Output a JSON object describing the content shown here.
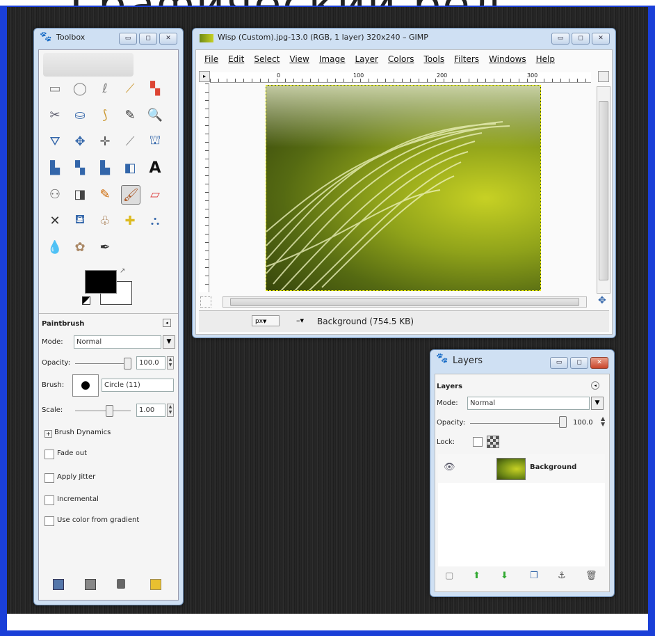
{
  "heading": "Графический ред",
  "toolbox": {
    "title": "Toolbox",
    "controls": [
      "▭",
      "◻",
      "✕"
    ],
    "tools_row1": [
      "▭",
      "◯",
      "ℓ",
      "⟋",
      "▚"
    ],
    "tools_row2": [
      "✂",
      "⛀",
      "⟆",
      "✎",
      "🔍"
    ],
    "tools_row3": [
      "⛛",
      "✥",
      "✛",
      "⟋",
      "⛫"
    ],
    "tools_row4": [
      "▙",
      "▚",
      "▙",
      "◧",
      "A"
    ],
    "tools_row5": [
      "⚇",
      "◨",
      "✎",
      "🖌",
      "▱"
    ],
    "tools_row6": [
      "✕",
      "⛾",
      "♧",
      "✚",
      "⛬"
    ],
    "tools_row7": [
      "💧",
      "✿",
      "✒"
    ],
    "options_title": "Paintbrush",
    "mode_label": "Mode:",
    "mode_value": "Normal",
    "opacity_label": "Opacity:",
    "opacity_value": "100.0",
    "brush_label": "Brush:",
    "brush_value": "Circle (11)",
    "scale_label": "Scale:",
    "scale_value": "1.00",
    "dynamics_label": "Brush Dynamics",
    "checks": [
      "Fade out",
      "Apply Jitter",
      "Incremental",
      "Use color from gradient"
    ]
  },
  "image_window": {
    "title": "Wisp (Custom).jpg-13.0 (RGB, 1 layer) 320x240 – GIMP",
    "controls": [
      "▭",
      "◻",
      "✕"
    ],
    "menu": [
      "File",
      "Edit",
      "Select",
      "View",
      "Image",
      "Layer",
      "Colors",
      "Tools",
      "Filters",
      "Windows",
      "Help"
    ],
    "ruler_marks": [
      "0",
      "100",
      "200",
      "300"
    ],
    "unit": "px",
    "status": "Background (754.5 KB)"
  },
  "layers": {
    "title": "Layers",
    "controls": [
      "▭",
      "◻",
      "✕"
    ],
    "panel_title": "Layers",
    "mode_label": "Mode:",
    "mode_value": "Normal",
    "opacity_label": "Opacity:",
    "opacity_value": "100.0",
    "lock_label": "Lock:",
    "layer_name": "Background"
  },
  "colors": {
    "frame": "#1a3fd8",
    "canvas_yellow": "#c7d124",
    "canvas_dark": "#2e3b0a"
  }
}
